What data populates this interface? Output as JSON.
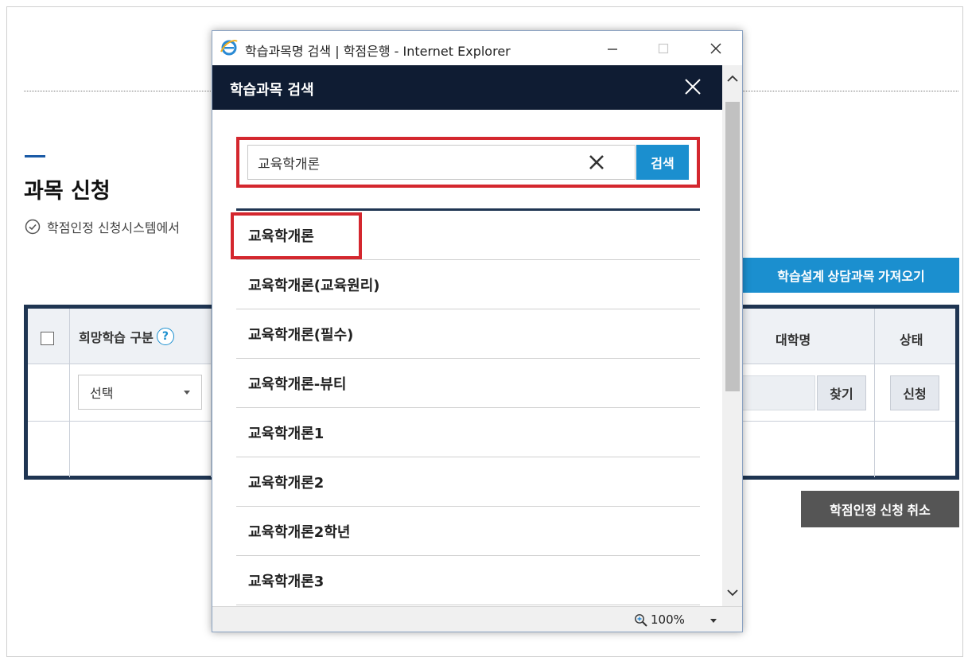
{
  "background": {
    "page_title": "과목 신청",
    "notice": "학점인정 신청시스템에서",
    "import_button": "학습설계 상담과목 가져오기",
    "cancel_button": "학점인정 신청 취소",
    "table": {
      "header_learning_type": "희망학습 구분",
      "help_symbol": "?",
      "header_university": "대학명",
      "header_status": "상태",
      "select_value": "선택",
      "find_button": "찾기",
      "apply_button": "신청"
    }
  },
  "popup": {
    "window_title": "학습과목명 검색 | 학점은행 - Internet Explorer",
    "modal_title": "학습과목 검색",
    "search": {
      "value": "교육학개론",
      "button": "검색"
    },
    "results": [
      "교육학개론",
      "교육학개론(교육원리)",
      "교육학개론(필수)",
      "교육학개론-뷰티",
      "교육학개론1",
      "교육학개론2",
      "교육학개론2학년",
      "교육학개론3"
    ],
    "zoom": "100%"
  },
  "colors": {
    "navy": "#0f1c33",
    "accent_blue": "#1b8fcf",
    "highlight_red": "#d4272e",
    "table_border": "#1f3552",
    "cancel_gray": "#555555"
  },
  "icons": [
    "check-circle-icon",
    "help-icon",
    "chevron-down-icon",
    "ie-logo-icon",
    "minimize-icon",
    "maximize-icon",
    "close-icon",
    "clear-icon",
    "scroll-up-icon",
    "scroll-down-icon",
    "zoom-icon"
  ]
}
